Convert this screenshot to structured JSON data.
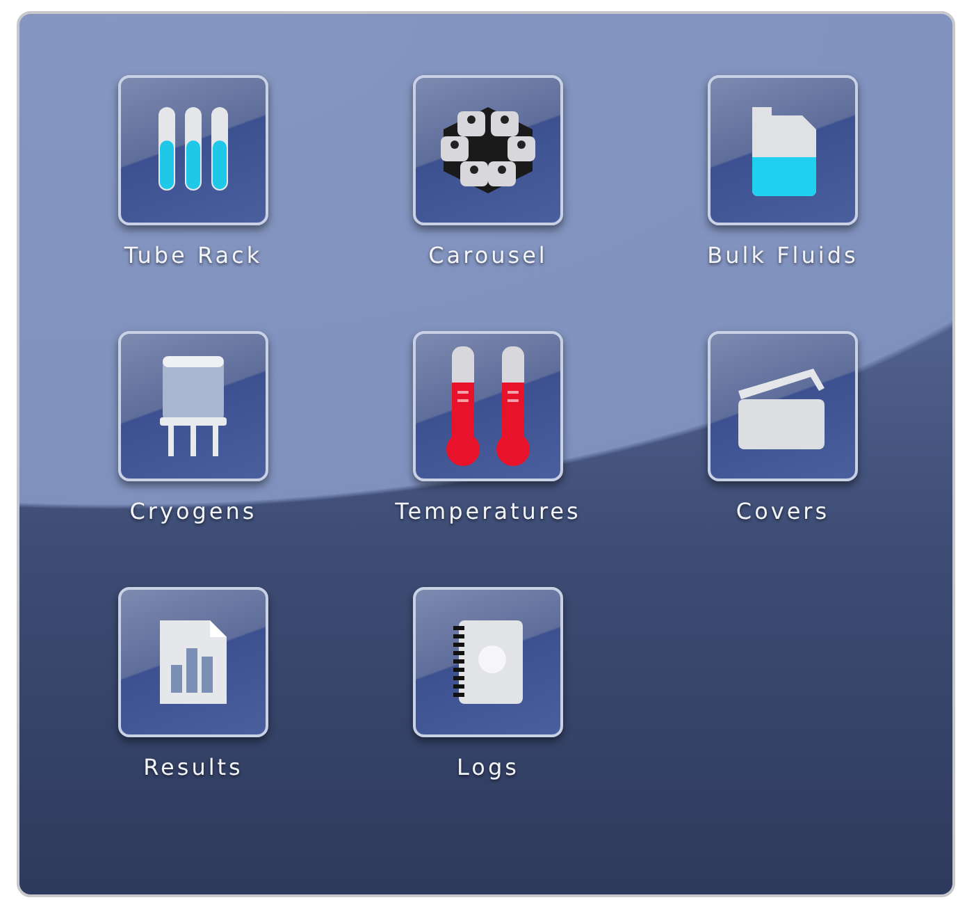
{
  "items": [
    {
      "label": "Tube Rack",
      "kind": "tubes"
    },
    {
      "label": "Carousel",
      "kind": "carousel"
    },
    {
      "label": "Bulk Fluids",
      "kind": "jug"
    },
    {
      "label": "Cryogens",
      "kind": "tank"
    },
    {
      "label": "Temperatures",
      "kind": "thermometers"
    },
    {
      "label": "Covers",
      "kind": "cover"
    },
    {
      "label": "Results",
      "kind": "report"
    },
    {
      "label": "Logs",
      "kind": "notebook"
    }
  ]
}
